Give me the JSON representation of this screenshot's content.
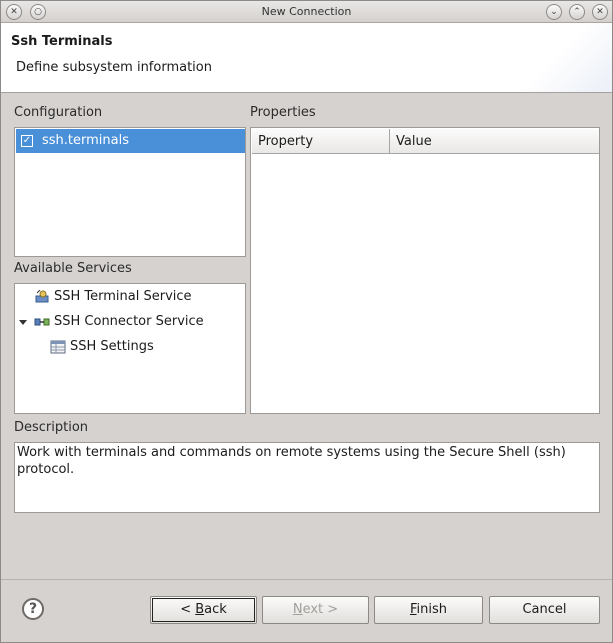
{
  "window": {
    "title": "New Connection"
  },
  "header": {
    "title": "Ssh Terminals",
    "subtitle": "Define subsystem information"
  },
  "configuration": {
    "label": "Configuration",
    "items": [
      {
        "label": "ssh.terminals",
        "checked": true,
        "selected": true
      }
    ]
  },
  "services": {
    "label": "Available Services",
    "items": [
      {
        "label": "SSH Terminal Service",
        "icon": "terminal-service-icon"
      },
      {
        "label": "SSH Connector Service",
        "icon": "connector-icon",
        "expanded": true
      },
      {
        "label": "SSH Settings",
        "icon": "settings-table-icon"
      }
    ]
  },
  "properties": {
    "label": "Properties",
    "columns": [
      "Property",
      "Value"
    ]
  },
  "description": {
    "label": "Description",
    "text": "Work with terminals and commands on remote systems using the Secure Shell (ssh) protocol."
  },
  "buttons": {
    "back_prefix": "< ",
    "back_accel": "B",
    "back_rest": "ack",
    "next_accel": "N",
    "next_rest": "ext >",
    "finish_accel": "F",
    "finish_rest": "inish",
    "cancel": "Cancel"
  },
  "colors": {
    "selection": "#4a90d9",
    "background": "#d6d2d0"
  }
}
